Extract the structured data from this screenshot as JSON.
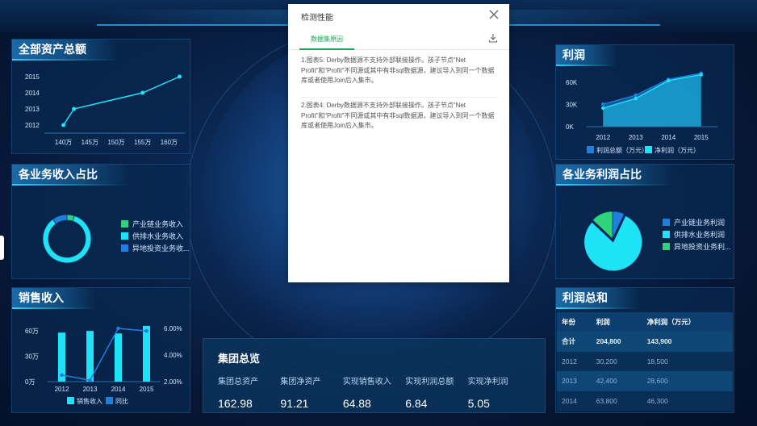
{
  "colors": {
    "cyan": "#1ee3f7",
    "blue": "#1d7fe0",
    "green": "#2fd37a",
    "panel": "#0b3566"
  },
  "assets_panel": {
    "title": "全部资产总额",
    "chart_data": {
      "type": "line",
      "title": "全部资产总额",
      "x_tick_labels": [
        "140万",
        "145万",
        "150万",
        "155万",
        "160万"
      ],
      "y_tick_labels": [
        "2012",
        "2013",
        "2014",
        "2015"
      ],
      "points": [
        {
          "x": 140,
          "y": 2012
        },
        {
          "x": 142,
          "y": 2013
        },
        {
          "x": 155,
          "y": 2014
        },
        {
          "x": 162,
          "y": 2015
        }
      ],
      "xlim": [
        137,
        163
      ],
      "ylim": [
        2011.8,
        2015.3
      ]
    }
  },
  "business_income_panel": {
    "title": "各业务收入占比",
    "chart_data": {
      "type": "pie",
      "style": "donut",
      "labels": [
        "产业链业务收入",
        "供排水业务收入",
        "异地投资业务收..."
      ],
      "values": [
        5,
        85,
        10
      ],
      "colors": [
        "#2fd37a",
        "#1ee3f7",
        "#1d7fe0"
      ]
    }
  },
  "sales_panel": {
    "title": "销售收入",
    "chart_data": {
      "type": "bar",
      "categories": [
        "2012",
        "2013",
        "2014",
        "2015"
      ],
      "left_axis_ticks": [
        "0万",
        "30万",
        "60万"
      ],
      "right_axis_ticks": [
        "2.00%",
        "4.00%",
        "6.00%"
      ],
      "series": [
        {
          "name": "销售收入",
          "type": "bar",
          "values": [
            58,
            60,
            57,
            66
          ],
          "color": "#1ee3f7",
          "ylim": [
            0,
            63
          ]
        },
        {
          "name": "同比",
          "type": "line",
          "values": [
            2.5,
            2.1,
            6.0,
            5.8
          ],
          "color": "#1d7fe0",
          "ylim": [
            2.0,
            6.0
          ]
        }
      ]
    }
  },
  "profit_panel": {
    "title": "利润",
    "chart_data": {
      "type": "area",
      "categories": [
        "2012",
        "2013",
        "2014",
        "2015"
      ],
      "y_tick_labels": [
        "0K",
        "30K",
        "60K"
      ],
      "ylim": [
        0,
        75
      ],
      "series": [
        {
          "name": "利润总额（万元）",
          "values": [
            30.2,
            42.4,
            63.8,
            72.0
          ],
          "color": "#1d7fe0"
        },
        {
          "name": "净利润（万元）",
          "values": [
            25.0,
            38.0,
            62.0,
            70.0
          ],
          "color": "#1ee3f7"
        }
      ]
    }
  },
  "business_profit_panel": {
    "title": "各业务利润占比",
    "chart_data": {
      "type": "pie",
      "labels": [
        "产业链业务利润",
        "供排水业务利润",
        "异地投资业务利..."
      ],
      "values": [
        7,
        80,
        13
      ],
      "colors": [
        "#1d7fe0",
        "#1ee3f7",
        "#2fd37a"
      ]
    }
  },
  "profit_total_panel": {
    "title": "利润总和",
    "headers": [
      "年份",
      "利润",
      "净利润（万元）"
    ],
    "rows": [
      [
        "合计",
        "204,800",
        "143,900"
      ],
      [
        "2012",
        "30,200",
        "18,500"
      ],
      [
        "2013",
        "42,400",
        "28,600"
      ],
      [
        "2014",
        "63,800",
        "46,300"
      ]
    ]
  },
  "group_overview": {
    "title": "集团总览",
    "items": [
      {
        "label": "集团总资产",
        "value": "162.98"
      },
      {
        "label": "集团净资产",
        "value": "91.21"
      },
      {
        "label": "实现销售收入",
        "value": "64.88"
      },
      {
        "label": "实现利润总额",
        "value": "6.84"
      },
      {
        "label": "实现净利润",
        "value": "5.05"
      }
    ]
  },
  "modal": {
    "title": "检测性能",
    "tab": "数据集原因",
    "messages": [
      "1.图表5: Derby数据源不支持外部联接操作。孩子节点“Net Profit”和“Profit”不同源或其中有非sql数据源，建议导入到同一个数据库或者使用Join后入集市。",
      "2.图表4: Derby数据源不支持外部联接操作。孩子节点“Net Profit”和“Profit”不同源或其中有非sql数据源，建议导入到同一个数据库或者使用Join后入集市。"
    ]
  }
}
